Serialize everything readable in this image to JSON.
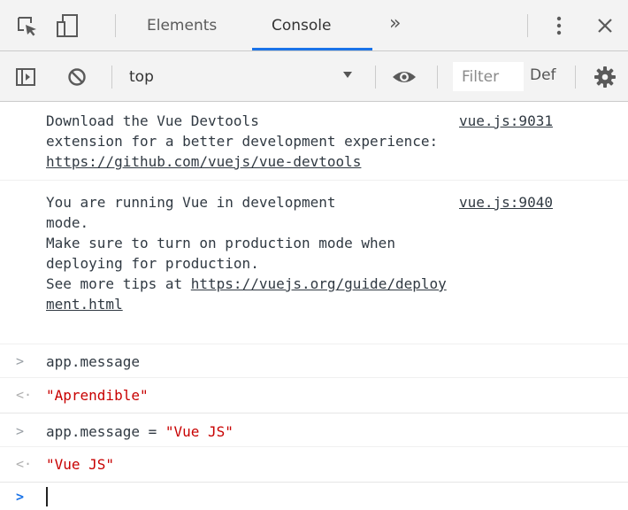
{
  "tabbar": {
    "tabs": [
      {
        "label": "Elements",
        "active": false
      },
      {
        "label": "Console",
        "active": true
      }
    ],
    "more_tabs": "»",
    "close": "✕"
  },
  "toolbar": {
    "context": "top",
    "filter_placeholder": "Filter",
    "levels_label": "Def"
  },
  "console": {
    "messages": [
      {
        "lines": [
          "Download the Vue Devtools",
          "extension for a better development experience:"
        ],
        "url": "https://github.com/vuejs/vue-devtools",
        "source": "vue.js:9031"
      },
      {
        "lines": [
          "You are running Vue in development",
          "mode.",
          "Make sure to turn on production mode when",
          "deploying for production.",
          "See more tips at "
        ],
        "url_part1": "https://vuejs.org/guide/deploy",
        "url_part2": "ment.html",
        "source": "vue.js:9040"
      }
    ],
    "history": [
      {
        "input": "app.message",
        "result": "\"Aprendible\""
      },
      {
        "input_code": "app.message = ",
        "input_string": "\"Vue JS\"",
        "result": "\"Vue JS\""
      }
    ],
    "prompt_glyph": ">",
    "result_glyph": "<·"
  },
  "colors": {
    "accent": "#1a73e8",
    "string": "#c80000",
    "toolbar_bg": "#f3f3f3"
  }
}
